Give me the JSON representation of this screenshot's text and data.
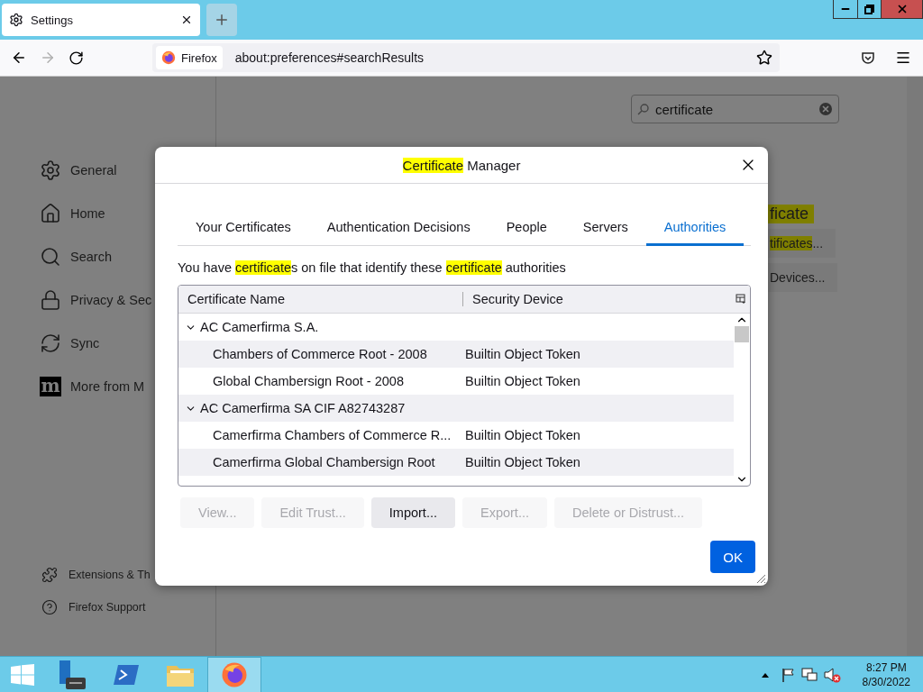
{
  "browser_tabs": [
    {
      "label": "Settings",
      "selected": true
    }
  ],
  "address_bar": {
    "identity": "Firefox",
    "url": "about:preferences#searchResults"
  },
  "sidebar": {
    "items": [
      {
        "label": "General"
      },
      {
        "label": "Home"
      },
      {
        "label": "Search"
      },
      {
        "label": "Privacy & Sec"
      },
      {
        "label": "Sync"
      },
      {
        "label": "More from M",
        "logo": "m"
      }
    ],
    "footer": [
      {
        "label": "Extensions & Th"
      },
      {
        "label": "Firefox Support"
      }
    ]
  },
  "search": {
    "value": "certificate"
  },
  "background_results": {
    "heading": "ficate",
    "buttons": [
      [
        {
          "text": "tificates",
          "highlight": true
        },
        {
          "text": "...",
          "highlight": false
        }
      ],
      [
        {
          "text": "Devices...",
          "highlight": false
        }
      ]
    ]
  },
  "dialog": {
    "title": [
      {
        "text": "Certificate",
        "highlight": true
      },
      {
        "text": " Manager",
        "highlight": false
      }
    ],
    "tabs": [
      {
        "label": "Your Certificates",
        "selected": false
      },
      {
        "label": "Authentication Decisions",
        "selected": false
      },
      {
        "label": "People",
        "selected": false
      },
      {
        "label": "Servers",
        "selected": false
      },
      {
        "label": "Authorities",
        "selected": true
      }
    ],
    "description": [
      {
        "text": "You have ",
        "highlight": false
      },
      {
        "text": "certificate",
        "highlight": true
      },
      {
        "text": "s on file that identify these ",
        "highlight": false
      },
      {
        "text": "certificate",
        "highlight": true
      },
      {
        "text": " authorities",
        "highlight": false
      }
    ],
    "table": {
      "columns": [
        "Certificate Name",
        "Security Device"
      ],
      "rows": [
        {
          "name": "AC Camerfirma S.A.",
          "expanded": true,
          "children": [
            {
              "name": "Chambers of Commerce Root - 2008",
              "device": "Builtin Object Token"
            },
            {
              "name": "Global Chambersign Root - 2008",
              "device": "Builtin Object Token"
            }
          ]
        },
        {
          "name": "AC Camerfirma SA CIF A82743287",
          "expanded": true,
          "children": [
            {
              "name": "Camerfirma Chambers of Commerce R...",
              "device": "Builtin Object Token"
            },
            {
              "name": "Camerfirma Global Chambersign Root",
              "device": "Builtin Object Token"
            }
          ]
        }
      ]
    },
    "buttons": [
      {
        "label": "View...",
        "disabled": true
      },
      {
        "label": "Edit Trust...",
        "disabled": true
      },
      {
        "label": "Import...",
        "disabled": false
      },
      {
        "label": "Export...",
        "disabled": true
      },
      {
        "label": "Delete or Distrust...",
        "disabled": true
      }
    ],
    "ok": "OK"
  },
  "taskbar": {
    "time": "8:27 PM",
    "date": "8/30/2022"
  }
}
